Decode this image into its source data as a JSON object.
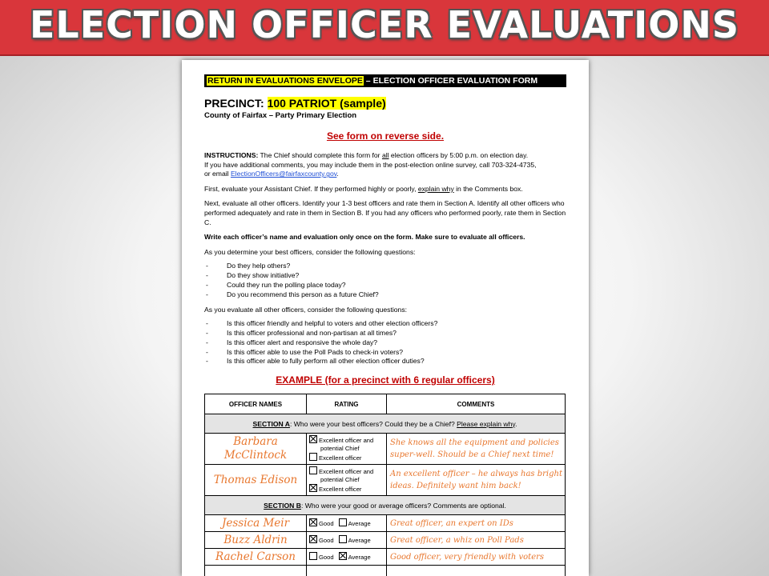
{
  "banner": {
    "title": "ELECTION OFFICER EVALUATIONS"
  },
  "form": {
    "header_highlight": "RETURN IN EVALUATIONS ENVELOPE",
    "header_rest": " – ELECTION OFFICER EVALUATION FORM",
    "precinct_label": "PRECINCT: ",
    "precinct_value": "100 PATRIOT (sample)",
    "county": "County of Fairfax – Party Primary Election",
    "reverse_note": "See form on reverse side.",
    "instructions_label": "INSTRUCTIONS:",
    "instructions_a": " The Chief should complete this form for ",
    "instructions_all": "all",
    "instructions_b": " election officers by 5:00 p.m. on election day.",
    "instructions_c": "If you have additional comments, you may include them in the post-election online survey, call 703-324-4735,",
    "instructions_d": "or email ",
    "email": "ElectionOfficers@fairfaxcounty.gov",
    "instructions_e": ".",
    "first_a": "First, evaluate your Assistant Chief. If they performed highly or poorly, ",
    "first_link": "explain why",
    "first_b": " in the Comments box.",
    "next_text": "Next, evaluate all other officers. Identify your 1-3 best officers and rate them in Section A. Identify all other officers who performed adequately and rate in them in Section B. If you had any officers who performed poorly, rate them in Section C.",
    "bold_note": "Write each officer’s name and evaluation only once on the form. Make sure to evaluate all officers.",
    "best_intro": "As you determine your best officers, consider the following questions:",
    "best_questions": [
      "Do they help others?",
      "Do they show initiative?",
      "Could they run the polling place today?",
      "Do you recommend this person as a future Chief?"
    ],
    "other_intro": "As you evaluate all other officers, consider the following questions:",
    "other_questions": [
      "Is this officer friendly and helpful to voters and other election officers?",
      "Is this officer professional and non-partisan at all times?",
      "Is this officer alert and responsive the whole day?",
      "Is this officer able to use the Poll Pads to check-in voters?",
      "Is this officer able to fully perform all other election officer duties?"
    ],
    "example_title": "EXAMPLE (for a precinct with 6 regular officers)"
  },
  "table": {
    "headers": [
      "OFFICER NAMES",
      "RATING",
      "COMMENTS"
    ],
    "section_a_label": "SECTION A",
    "section_a_text": ": Who were your best officers? Could they be a Chief? ",
    "section_a_link": "Please explain why",
    "section_a_end": ".",
    "rating_a_top_1": "Excellent officer and",
    "rating_a_top_2": "potential Chief",
    "rating_a_bottom": "Excellent officer",
    "section_a_rows": [
      {
        "name": "Barbara McClintock",
        "comment": "She knows all the equipment and policies super-well. Should be a Chief next time!"
      },
      {
        "name": "Thomas Edison",
        "comment": "An excellent officer – he always has bright ideas. Definitely want him back!"
      }
    ],
    "section_b_label": "SECTION B",
    "section_b_text": ": Who were your good or average officers? Comments are optional.",
    "rating_good": "Good",
    "rating_average": "Average",
    "section_b_rows": [
      {
        "name": "Jessica Meir",
        "comment": "Great officer, an expert on IDs"
      },
      {
        "name": "Buzz Aldrin",
        "comment": "Great officer, a whiz on Poll Pads"
      },
      {
        "name": "Rachel Carson",
        "comment": "Good officer, very friendly with voters"
      }
    ]
  }
}
